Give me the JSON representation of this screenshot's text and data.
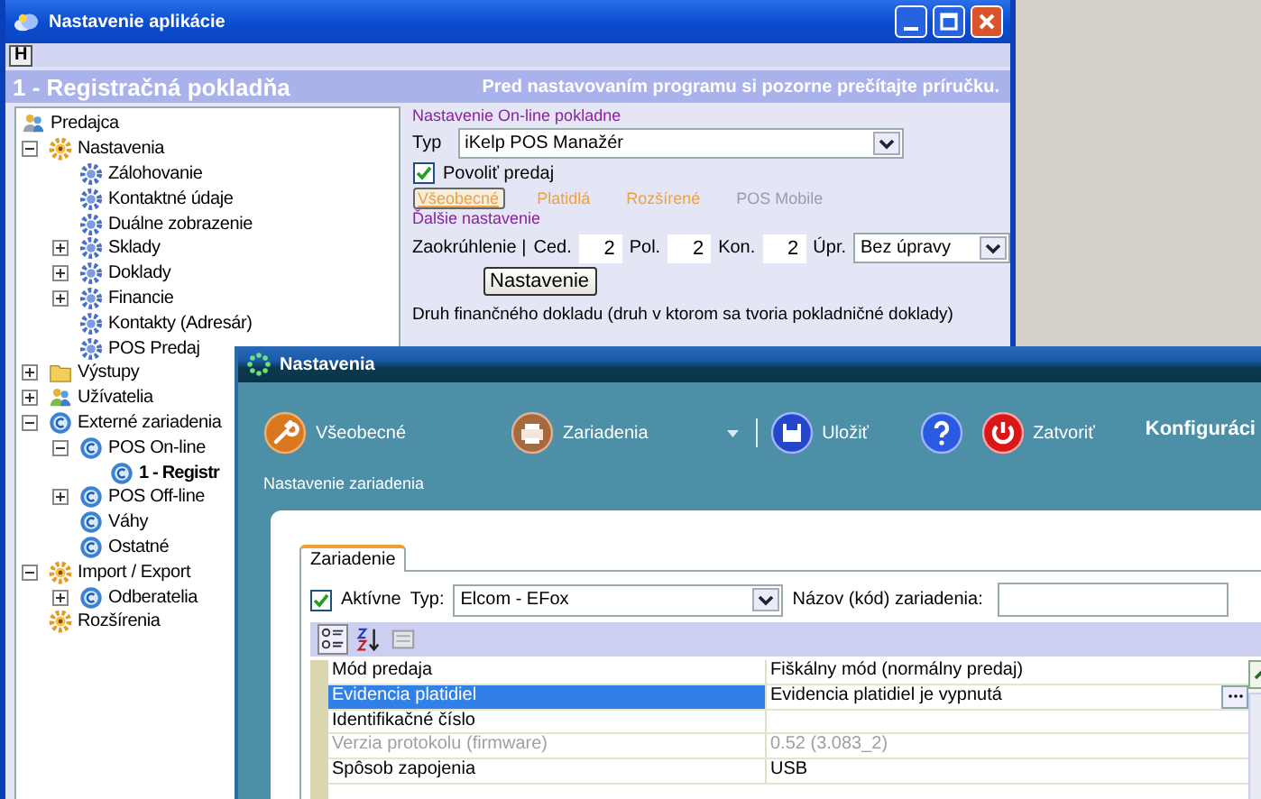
{
  "back_window": {
    "title": "Nastavenie aplikácie",
    "h_button": "H",
    "header_title": "1 - Registračná pokladňa",
    "header_note": "Pred nastavovaním programu si pozorne prečítajte príručku.",
    "tree": [
      {
        "label": "Predajca",
        "kind": "company",
        "selected": false,
        "children": [
          {
            "label": "Nastavenia",
            "kind": "group",
            "expanded": true,
            "selected": false,
            "children": [
              {
                "label": "Zálohovanie",
                "kind": "setting",
                "selected": false
              },
              {
                "label": "Kontaktné údaje",
                "kind": "setting",
                "selected": false
              },
              {
                "label": "Duálne zobrazenie",
                "kind": "setting",
                "selected": false
              },
              {
                "label": "Sklady",
                "kind": "setting",
                "expanded": false,
                "selected": false
              },
              {
                "label": "Doklady",
                "kind": "setting",
                "expanded": false,
                "selected": false
              },
              {
                "label": "Financie",
                "kind": "setting",
                "expanded": false,
                "selected": false
              },
              {
                "label": "Kontakty (Adresár)",
                "kind": "setting",
                "selected": false
              },
              {
                "label": "POS Predaj",
                "kind": "setting",
                "selected": false
              }
            ]
          },
          {
            "label": "Výstupy",
            "kind": "folder",
            "expanded": false,
            "selected": false
          },
          {
            "label": "Užívatelia",
            "kind": "users",
            "expanded": false,
            "selected": false
          },
          {
            "label": "Externé zariadenia",
            "kind": "device",
            "expanded": true,
            "selected": false,
            "children": [
              {
                "label": "POS On-line",
                "kind": "device",
                "expanded": true,
                "selected": false,
                "children": [
                  {
                    "label": "1 - Registr",
                    "kind": "device",
                    "selected": true
                  }
                ]
              },
              {
                "label": "POS Off-line",
                "kind": "device",
                "expanded": false,
                "selected": false
              },
              {
                "label": "Váhy",
                "kind": "device",
                "selected": false
              },
              {
                "label": "Ostatné",
                "kind": "device",
                "selected": false
              }
            ]
          },
          {
            "label": "Import / Export",
            "kind": "group",
            "expanded": true,
            "selected": false,
            "children": [
              {
                "label": "Odberatelia",
                "kind": "device",
                "expanded": false,
                "selected": false
              }
            ]
          },
          {
            "label": "Rozšírenia",
            "kind": "group",
            "selected": false
          }
        ]
      }
    ],
    "online": {
      "section_label": "Nastavenie On-line pokladne",
      "type_label": "Typ",
      "type_value": "iKelp POS Manažér",
      "allow_sale": {
        "label": "Povoliť predaj",
        "checked": true
      },
      "tabs": [
        {
          "label": "Všeobecné",
          "selected": true,
          "disabled": false
        },
        {
          "label": "Platidlá",
          "selected": false,
          "disabled": false
        },
        {
          "label": "Rozšírené",
          "selected": false,
          "disabled": false
        },
        {
          "label": "POS Mobile",
          "selected": false,
          "disabled": true
        }
      ],
      "more_label": "Ďalšie nastavenie",
      "rounding": {
        "label": "Zaokrúhlenie |",
        "fields": [
          {
            "label": "Ced.",
            "value": "2"
          },
          {
            "label": "Pol.",
            "value": "2"
          },
          {
            "label": "Kon.",
            "value": "2"
          }
        ],
        "adjust_label": "Úpr.",
        "adjust_value": "Bez úpravy"
      },
      "settings_button": "Nastavenie",
      "doc_type_label": "Druh finančného dokladu (druh v ktorom sa tvoria pokladničné doklady)"
    }
  },
  "front_window": {
    "title": "Nastavenia",
    "toolbar": [
      {
        "kind": "general",
        "label": "Všeobecné"
      },
      {
        "kind": "devices",
        "label": "Zariadenia"
      },
      {
        "kind": "dropdown"
      },
      {
        "kind": "separator"
      },
      {
        "kind": "save",
        "label": "Uložiť"
      },
      {
        "kind": "help"
      },
      {
        "kind": "close",
        "label": "Zatvoriť"
      }
    ],
    "heading": "Konfiguráci",
    "subtitle": "Nastavenie zariadenia",
    "tabs": [
      {
        "label": "Zariadenie",
        "selected": true
      }
    ],
    "active": {
      "label": "Aktívne",
      "checked": true
    },
    "type_label": "Typ:",
    "type_value": "Elcom - EFox",
    "name_label": "Názov (kód) zariadenia:",
    "properties": [
      {
        "name": "Mód predaja",
        "value": "Fiškálny mód (normálny predaj)",
        "selected": false,
        "disabled": false
      },
      {
        "name": "Evidencia platidiel",
        "value": "Evidencia platidiel je vypnutá",
        "selected": true,
        "disabled": false
      },
      {
        "name": "Identifikačné číslo",
        "selected": false,
        "disabled": false
      },
      {
        "name": "Verzia protokolu (firmware)",
        "value": "0.52 (3.083_2)",
        "selected": false,
        "disabled": true
      },
      {
        "name": "Spôsob zapojenia",
        "value": "USB",
        "selected": false,
        "disabled": false
      }
    ]
  }
}
